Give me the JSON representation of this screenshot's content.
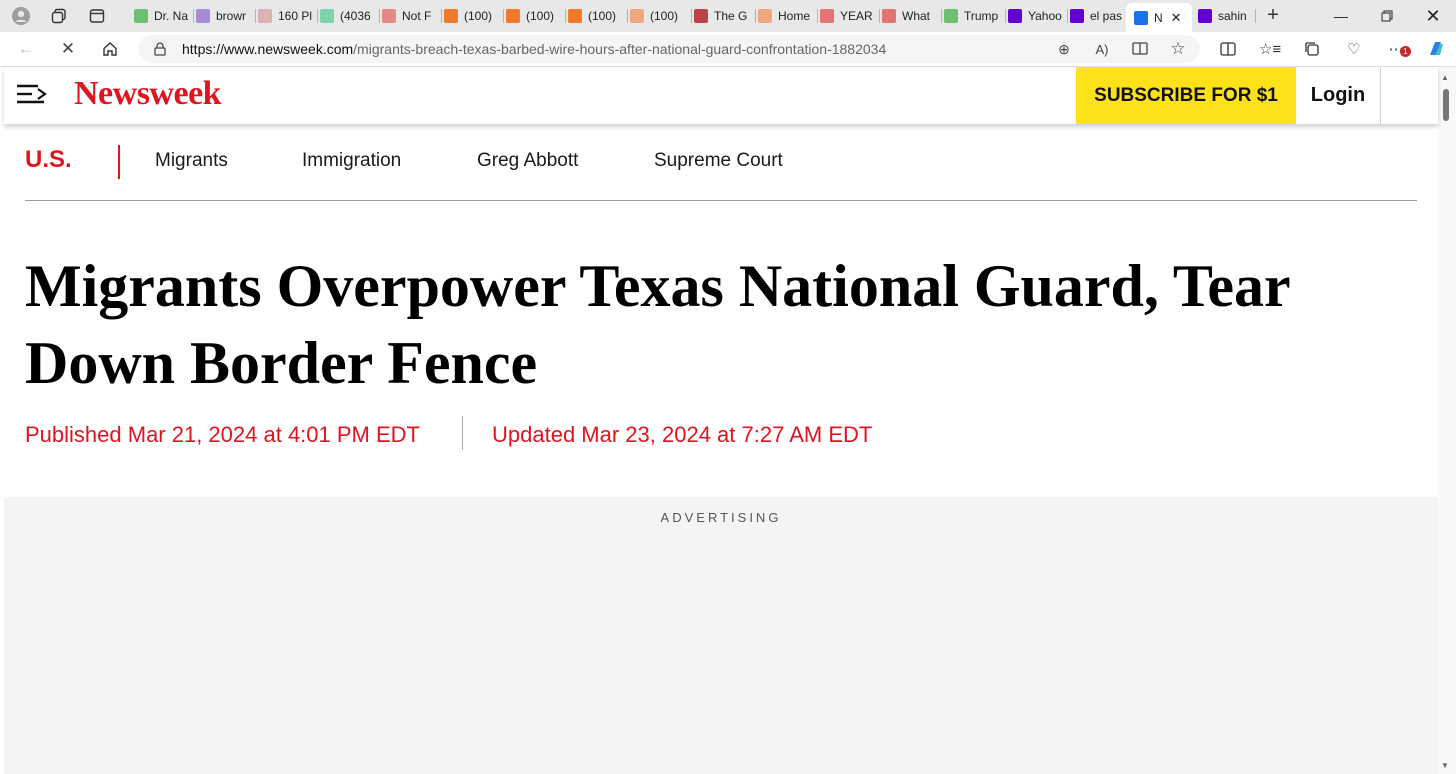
{
  "browser": {
    "tabs": [
      {
        "title": "Dr. Na",
        "icon": "video-play-icon",
        "color": "#6fbf73"
      },
      {
        "title": "browr",
        "icon": "yahoo-icon",
        "color": "#a78bd6"
      },
      {
        "title": "160 Pl",
        "icon": "business-insider-icon",
        "color": "#d9b2b2"
      },
      {
        "title": "(4036",
        "icon": "grammarly-icon",
        "color": "#7fd3a8"
      },
      {
        "title": "Not F",
        "icon": "podcast-icon",
        "color": "#e28a8a"
      },
      {
        "title": "(100)",
        "icon": "bookmark-icon",
        "color": "#f07a2a"
      },
      {
        "title": "(100)",
        "icon": "bookmark-icon",
        "color": "#f07a2a"
      },
      {
        "title": "(100)",
        "icon": "bookmark-icon",
        "color": "#f07a2a"
      },
      {
        "title": "(100)",
        "icon": "bookmark-icon",
        "color": "#f0a880"
      },
      {
        "title": "The G",
        "icon": "ds-icon",
        "color": "#b44"
      },
      {
        "title": "Home",
        "icon": "bookmark-icon",
        "color": "#f0a880"
      },
      {
        "title": "YEAR",
        "icon": "youtube-icon",
        "color": "#e57373"
      },
      {
        "title": "What",
        "icon": "youtube-icon",
        "color": "#e57373"
      },
      {
        "title": "Trump",
        "icon": "video-play-icon",
        "color": "#6fbf73"
      },
      {
        "title": "Yahoo",
        "icon": "yahoo-icon",
        "color": "#6001d2"
      },
      {
        "title": "el pas",
        "icon": "yahoo-icon",
        "color": "#6001d2"
      },
      {
        "title": "N",
        "icon": "loading-spinner-icon",
        "color": "#1a73e8"
      },
      {
        "title": "sahin",
        "icon": "yahoo-icon",
        "color": "#6001d2"
      }
    ],
    "url_domain": "https://www.newsweek.com",
    "url_path": "/migrants-breach-texas-barbed-wire-hours-after-national-guard-confrontation-1882034",
    "extension_badge": "1"
  },
  "header": {
    "logo": "Newsweek",
    "subscribe_label": "SUBSCRIBE FOR $1",
    "login_label": "Login"
  },
  "subnav": {
    "section": "U.S.",
    "links": [
      "Migrants",
      "Immigration",
      "Greg Abbott",
      "Supreme Court"
    ]
  },
  "article": {
    "headline_line1": "Migrants Overpower Texas National Guard, Tear",
    "headline_line2": "Down Border Fence",
    "published": "Published Mar 21, 2024 at 4:01 PM EDT",
    "updated": "Updated Mar 23, 2024 at 7:27 AM EDT"
  },
  "ad": {
    "label": "ADVERTISING"
  },
  "colors": {
    "brand_red": "#e0141e",
    "subscribe_yellow": "#fde119"
  }
}
